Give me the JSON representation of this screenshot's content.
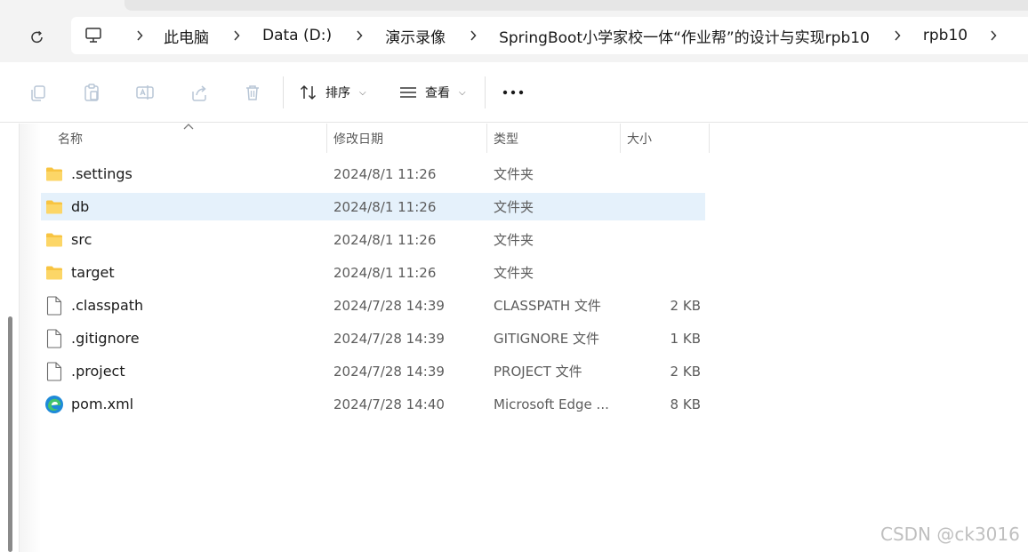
{
  "breadcrumb": [
    "此电脑",
    "Data (D:)",
    "演示录像",
    "SpringBoot小学家校一体“作业帮”的设计与实现rpb10",
    "rpb10"
  ],
  "toolbar": {
    "sort_label": "排序",
    "view_label": "查看"
  },
  "columns": {
    "name": "名称",
    "modified": "修改日期",
    "type": "类型",
    "size": "大小"
  },
  "files": [
    {
      "name": ".settings",
      "date": "2024/8/1 11:26",
      "type": "文件夹",
      "size": "",
      "icon": "folder-icon",
      "selected": false
    },
    {
      "name": "db",
      "date": "2024/8/1 11:26",
      "type": "文件夹",
      "size": "",
      "icon": "folder-icon",
      "selected": true
    },
    {
      "name": "src",
      "date": "2024/8/1 11:26",
      "type": "文件夹",
      "size": "",
      "icon": "folder-icon",
      "selected": false
    },
    {
      "name": "target",
      "date": "2024/8/1 11:26",
      "type": "文件夹",
      "size": "",
      "icon": "folder-icon",
      "selected": false
    },
    {
      "name": ".classpath",
      "date": "2024/7/28 14:39",
      "type": "CLASSPATH 文件",
      "size": "2 KB",
      "icon": "file-icon",
      "selected": false
    },
    {
      "name": ".gitignore",
      "date": "2024/7/28 14:39",
      "type": "GITIGNORE 文件",
      "size": "1 KB",
      "icon": "file-icon",
      "selected": false
    },
    {
      "name": ".project",
      "date": "2024/7/28 14:39",
      "type": "PROJECT 文件",
      "size": "2 KB",
      "icon": "file-icon",
      "selected": false
    },
    {
      "name": "pom.xml",
      "date": "2024/7/28 14:40",
      "type": "Microsoft Edge ...",
      "size": "8 KB",
      "icon": "edge-icon",
      "selected": false
    }
  ],
  "watermark": "CSDN @ck3016",
  "colors": {
    "selection": "#e5f1fb",
    "folder": "#f8c441",
    "toolbar_icon_disabled": "#b8c6d6"
  }
}
